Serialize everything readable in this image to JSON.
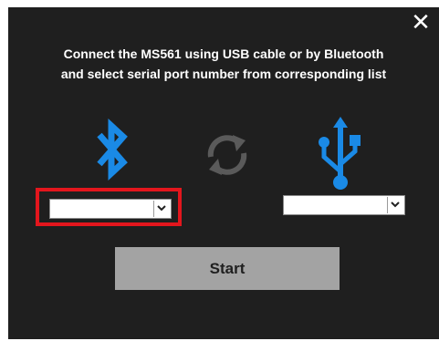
{
  "dialog": {
    "close_glyph": "✕",
    "instruction_line1": "Connect the MS561 using USB cable or by Bluetooth",
    "instruction_line2": "and select serial port number from corresponding list",
    "start_label": "Start"
  },
  "bluetooth_port": {
    "selected_value": ""
  },
  "usb_port": {
    "selected_value": ""
  },
  "icons": {
    "bluetooth": "bluetooth-icon",
    "sync": "sync-icon",
    "usb": "usb-icon",
    "dropdown": "chevron-down-icon"
  },
  "colors": {
    "background": "#1f1f1f",
    "accent_blue": "#1a8ae6",
    "sync_gray": "#5a5a5a",
    "highlight_red": "#e3161d",
    "start_button": "#a3a3a3"
  }
}
